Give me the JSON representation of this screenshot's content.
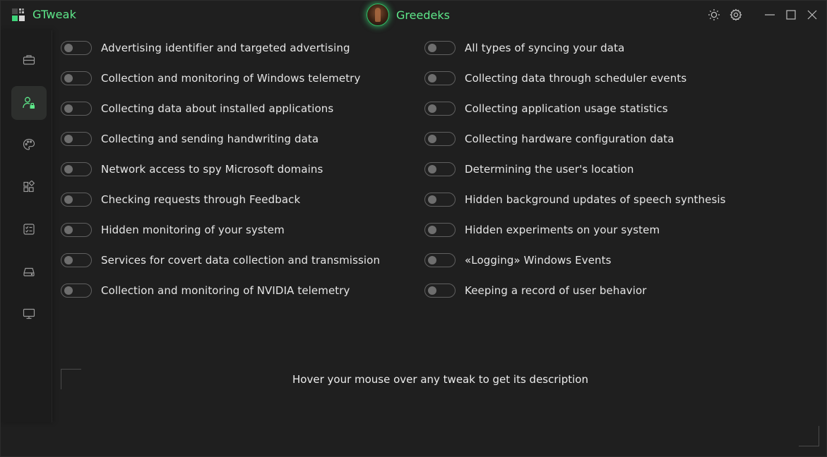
{
  "app": {
    "title": "GTweak",
    "user_name": "Greedeks",
    "accent_color": "#5ee88a"
  },
  "title_controls": [
    {
      "name": "theme-toggle",
      "icon": "sun-icon"
    },
    {
      "name": "settings",
      "icon": "gear-icon"
    },
    {
      "name": "minimize",
      "icon": "minimize-icon"
    },
    {
      "name": "maximize",
      "icon": "maximize-icon"
    },
    {
      "name": "close",
      "icon": "close-icon"
    }
  ],
  "sidebar": {
    "items": [
      {
        "name": "toolbox",
        "icon": "briefcase-icon",
        "active": false
      },
      {
        "name": "privacy",
        "icon": "user-lock-icon",
        "active": true
      },
      {
        "name": "interface",
        "icon": "palette-icon",
        "active": false
      },
      {
        "name": "applications",
        "icon": "apps-icon",
        "active": false
      },
      {
        "name": "services",
        "icon": "checklist-icon",
        "active": false
      },
      {
        "name": "system",
        "icon": "drive-icon",
        "active": false
      },
      {
        "name": "system-info",
        "icon": "monitor-icon",
        "active": false
      }
    ]
  },
  "tweaks": {
    "left": [
      {
        "label": "Advertising identifier and targeted advertising",
        "enabled": false
      },
      {
        "label": "Collection and monitoring of Windows telemetry",
        "enabled": false
      },
      {
        "label": "Collecting data about installed applications",
        "enabled": false
      },
      {
        "label": "Collecting and sending handwriting data",
        "enabled": false
      },
      {
        "label": "Network access to spy Microsoft domains",
        "enabled": false
      },
      {
        "label": "Checking requests through Feedback",
        "enabled": false
      },
      {
        "label": "Hidden monitoring of your system",
        "enabled": false
      },
      {
        "label": "Services for covert data collection and transmission",
        "enabled": false
      },
      {
        "label": "Collection and monitoring of NVIDIA telemetry",
        "enabled": false
      }
    ],
    "right": [
      {
        "label": "All types of syncing your data",
        "enabled": false
      },
      {
        "label": "Collecting data through scheduler events",
        "enabled": false
      },
      {
        "label": "Collecting application usage statistics",
        "enabled": false
      },
      {
        "label": "Collecting hardware configuration data",
        "enabled": false
      },
      {
        "label": "Determining the user's location",
        "enabled": false
      },
      {
        "label": "Hidden background updates of speech synthesis",
        "enabled": false
      },
      {
        "label": "Hidden experiments on your system",
        "enabled": false
      },
      {
        "label": "«Logging» Windows Events",
        "enabled": false
      },
      {
        "label": "Keeping a record of user behavior",
        "enabled": false
      }
    ]
  },
  "description": {
    "text": "Hover your mouse over any tweak to get its description"
  }
}
